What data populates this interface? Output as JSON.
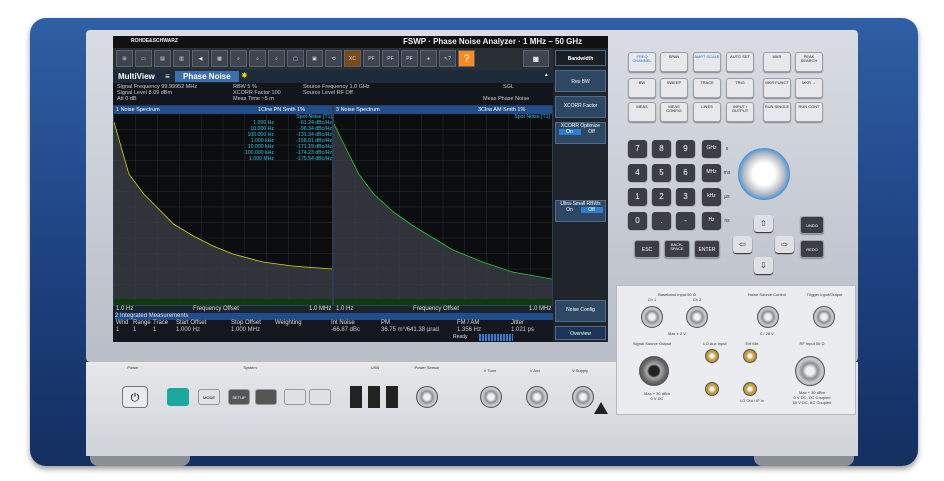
{
  "brand": "ROHDE&SCHWARZ",
  "model": "FSWP · Phase Noise Analyzer · 1 MHz – 50 GHz",
  "multiview": "MultiView",
  "channel_tab": "Phase Noise",
  "info": {
    "l1": "Signal Frequency 99.99952 MHz",
    "l2": "Signal Level         8.09 dBm",
    "l3": "Att                         0 dB",
    "m1": "RBW                      5 %",
    "m2": "XCORR Factor      100",
    "m3": "Meas Time        ~5 m",
    "r1": "Source Frequency  1.0 GHz",
    "r2": "Source Level         RF Off",
    "sgl": "SGL",
    "meas": "Meas Phase Noise"
  },
  "pane1": {
    "title": "1 Noise Spectrum",
    "trace": "1Clrw PN Smth 1%",
    "spot": "Spot Noise [T1]",
    "xstart": "1.0 Hz",
    "xcenter": "Frequency Offset",
    "xend": "1.0 MHz",
    "spot_rows": [
      [
        "1.000 Hz",
        "-61.24 dBc/Hz"
      ],
      [
        "10.000 Hz",
        "-98.34 dBc/Hz"
      ],
      [
        "100.000 Hz",
        "-131.34 dBc/Hz"
      ],
      [
        "1.000 kHz",
        "-158.01 dBc/Hz"
      ],
      [
        "10.000 kHz",
        "-171.19 dBc/Hz"
      ],
      [
        "100.000 kHz",
        "-174.23 dBc/Hz"
      ],
      [
        "1.000 MHz",
        "-175.54 dBc/Hz"
      ]
    ],
    "markers": [
      "SN1",
      "SN2",
      "SN3"
    ]
  },
  "pane3": {
    "title": "3 Noise Spectrum",
    "trace": "3Clrw AM Smth 1%",
    "spot": "Spot Noise [T1]",
    "xstart": "1.0 Hz",
    "xcenter": "Frequency Offset",
    "xend": "1.0 MHz"
  },
  "integrated": {
    "title": "2 Integrated Measurements",
    "headers": [
      "Wnd",
      "Range",
      "Trace",
      "Start Offset",
      "Stop Offset",
      "Weighting",
      "Int Noise",
      "PM",
      "FM / AM",
      "Jitter"
    ],
    "row": [
      "1",
      "1",
      "1",
      "1.000 Hz",
      "1.000 MHz",
      "",
      "-66.87 dBc",
      "36.75 m°/641.38 µrad",
      "1.356 Hz",
      "1.021 ps"
    ]
  },
  "status": "Ready",
  "softkeys": [
    "Bandwidth",
    "Res BW",
    "XCORR Factor",
    "XCORR Optimize",
    "On",
    "Off",
    "Ultra-Small RBWs",
    "On",
    "Off",
    "Noise Config",
    "Overview"
  ],
  "hardkeys": [
    "FREQ CHANNEL",
    "SPAN",
    "AMPT SCALE",
    "AUTO SET",
    "MKR",
    "PEAK SEARCH",
    "BW",
    "SWEEP",
    "TRACE",
    "TRIG",
    "MKR FUNCT",
    "MKR →",
    "MEAS",
    "MEAS CONFIG",
    "LINES",
    "INPUT / OUTPUT",
    "RUN SINGLE",
    "RUN CONT"
  ],
  "numpad": [
    "7",
    "8",
    "9",
    "4",
    "5",
    "6",
    "1",
    "2",
    "3",
    "0",
    ".",
    "-"
  ],
  "units": [
    "GHz",
    "MHz",
    "kHz",
    "Hz"
  ],
  "unit_side": [
    "s",
    "ms",
    "µs",
    "ns"
  ],
  "nav": [
    "ESC",
    "BACK-SPACE",
    "ENTER",
    "UNDO",
    "REDO"
  ],
  "front": {
    "power": "Power",
    "system": "System",
    "mode": "MODE",
    "setup": "SETUP",
    "usb": "USB",
    "power_sensor": "Power Sensor",
    "vtune": "V Tune",
    "vaux": "V Aux",
    "vsupply": "V Supply",
    "baseband": "Baseband Input 50 Ω",
    "ch1": "Ch 1",
    "ch2": "Ch 2",
    "maxv": "Max ± 2 V",
    "noise_src": "Noise Source Control",
    "ns_v": "0 / 28 V",
    "trigger": "Trigger Input/Output",
    "sig_out": "Signal Source Output",
    "lo_aux": "LO Aux Input",
    "ext_mix": "Ext Mix",
    "rf_in": "RF Input 50 Ω",
    "if_in": "IF In",
    "lo_out": "LO Out / IF In",
    "max30": "Max + 30 dBm",
    "v0": "0 V DC",
    "rf_max": "Max + 30 dBm",
    "rf_dc": "0 V DC, DC Coupled",
    "rf_ac": "50 V DC, AC Coupled"
  },
  "colors": {
    "trace": "#d6d900",
    "trace3": "#28c92e",
    "frame": "#2b5aa0"
  }
}
